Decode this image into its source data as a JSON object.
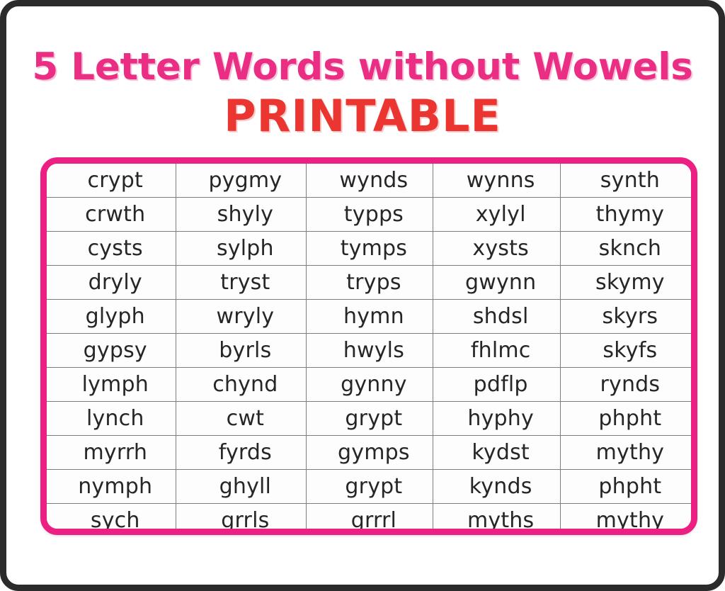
{
  "header": {
    "title_main": "5 Letter Words without Wowels",
    "title_sub": "PRINTABLE",
    "title_main_color": "#ea2e83",
    "title_sub_color": "#ea3530"
  },
  "table": {
    "border_color": "#ec1f82",
    "frame_color": "#2b2b2b",
    "grid_line_color": "#7d7d7d",
    "columns": 5,
    "rows_count": 11,
    "rows": [
      [
        "crypt",
        "pygmy",
        "wynds",
        "wynns",
        "synth"
      ],
      [
        "crwth",
        "shyly",
        "typps",
        "xylyl",
        "thymy"
      ],
      [
        "cysts",
        "sylph",
        "tymps",
        "xysts",
        "sknch"
      ],
      [
        "dryly",
        "tryst",
        "tryps",
        "gwynn",
        "skymy"
      ],
      [
        "glyph",
        "wryly",
        "hymn",
        "shdsl",
        "skyrs"
      ],
      [
        "gypsy",
        "byrls",
        "hwyls",
        "fhlmc",
        "skyfs"
      ],
      [
        "lymph",
        "chynd",
        "gynny",
        "pdflp",
        "rynds"
      ],
      [
        "lynch",
        "cwt",
        "grypt",
        "hyphy",
        "phpht"
      ],
      [
        "myrrh",
        "fyrds",
        "gymps",
        "kydst",
        "mythy"
      ],
      [
        "nymph",
        "ghyll",
        "grypt",
        "kynds",
        "phpht"
      ],
      [
        "sych",
        "grrls",
        "grrrl",
        "myths",
        "mythy"
      ]
    ]
  }
}
